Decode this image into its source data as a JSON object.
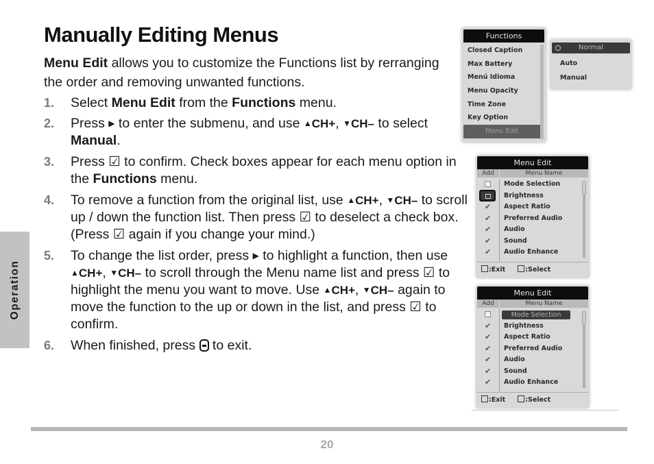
{
  "page": {
    "title": "Manually Editing Menus",
    "intro_bold": "Menu Edit",
    "intro_rest": " allows you to customize the Functions list by rerranging the order and removing unwanted functions.",
    "section_tab": "Operation",
    "page_number": "20"
  },
  "steps": [
    {
      "num": "1.",
      "parts": [
        "Select ",
        "Menu Edit",
        " from the ",
        "Functions",
        " menu."
      ]
    },
    {
      "num": "2.",
      "parts": [
        "Press ",
        "▶",
        " to enter the submenu, and use ",
        "▲",
        "CH+",
        ", ",
        "▼",
        "CH–",
        " to select ",
        "Manual",
        "."
      ]
    },
    {
      "num": "3.",
      "parts": [
        "Press ",
        "☑",
        " to confirm. Check boxes appear for each menu option in the ",
        "Functions",
        " menu."
      ]
    },
    {
      "num": "4.",
      "parts": [
        "To remove a function from the original list, use ",
        "▲",
        "CH+",
        ", ",
        "▼",
        "CH–",
        " to scroll up / down the function list. Then press ",
        "☑",
        " to deselect a check box. (Press ",
        "☑",
        " again if you change your mind.)"
      ]
    },
    {
      "num": "5.",
      "parts": [
        "To change the list order, press ",
        "▶",
        " to highlight a function, then use ",
        "▲",
        "CH+",
        ", ",
        "▼",
        "CH–",
        " to scroll through the Menu name list and press ",
        "☑",
        " to highlight the menu you want to move. Use ",
        "▲",
        "CH+",
        ", ",
        "▼",
        "CH–",
        " again to move the function to the up or down in the list, and press ",
        "☑",
        " to confirm."
      ]
    },
    {
      "num": "6.",
      "parts": [
        "When finished, press ",
        "exit-key",
        " to exit."
      ]
    }
  ],
  "functions_menu": {
    "header": "Functions",
    "items": [
      "Closed Caption",
      "Max Battery",
      "Menú Idioma",
      "Menu Opacity",
      "Time Zone",
      "Key Option"
    ],
    "selected": "Menu Edit"
  },
  "submenu": {
    "selected": "Normal",
    "items": [
      "Auto",
      "Manual"
    ]
  },
  "menu_edit_1": {
    "header": "Menu Edit",
    "col_add": "Add",
    "col_name": "Menu Name",
    "rows": [
      {
        "name": "Mode Selection",
        "check": "empty"
      },
      {
        "name": "Brightness",
        "check": "highlighted"
      },
      {
        "name": "Aspect Ratio",
        "check": "checked"
      },
      {
        "name": "Preferred Audio",
        "check": "checked"
      },
      {
        "name": "Audio",
        "check": "checked"
      },
      {
        "name": "Sound",
        "check": "checked"
      },
      {
        "name": "Audio Enhance",
        "check": "checked"
      }
    ],
    "footer_exit": ":Exit",
    "footer_select": ":Select"
  },
  "menu_edit_2": {
    "header": "Menu Edit",
    "col_add": "Add",
    "col_name": "Menu Name",
    "highlighted_row": 0,
    "rows": [
      {
        "name": "Mode Selection",
        "check": "empty"
      },
      {
        "name": "Brightness",
        "check": "checked"
      },
      {
        "name": "Aspect Ratio",
        "check": "checked"
      },
      {
        "name": "Preferred Audio",
        "check": "checked"
      },
      {
        "name": "Audio",
        "check": "checked"
      },
      {
        "name": "Sound",
        "check": "checked"
      },
      {
        "name": "Audio Enhance",
        "check": "checked"
      }
    ],
    "footer_exit": ":Exit",
    "footer_select": ":Select"
  }
}
